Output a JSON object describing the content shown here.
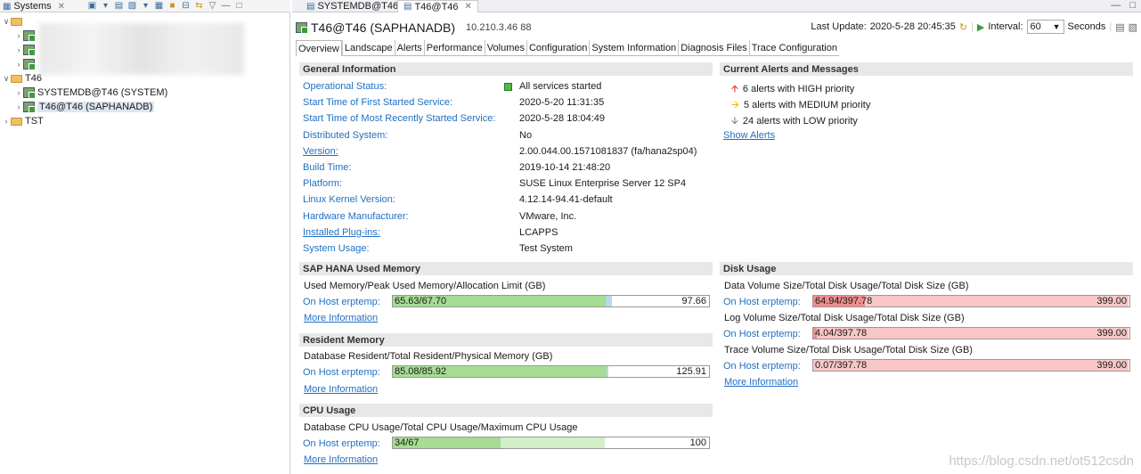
{
  "left_panel": {
    "tab_title": "Systems",
    "tree": [
      {
        "label": "",
        "level": 0,
        "expanded": true
      },
      {
        "label": "",
        "level": 1
      },
      {
        "label": "",
        "level": 1
      },
      {
        "label": "",
        "level": 1
      },
      {
        "label": "T46",
        "level": 0,
        "expanded": true
      },
      {
        "label": "SYSTEMDB@T46 (SYSTEM)",
        "level": 1
      },
      {
        "label": "T46@T46 (SAPHANADB)",
        "level": 1,
        "selected": true
      },
      {
        "label": "TST",
        "level": 0
      }
    ]
  },
  "editor_tabs": [
    {
      "label": "SYSTEMDB@T46",
      "active": false
    },
    {
      "label": "T46@T46",
      "active": true
    }
  ],
  "header": {
    "title": "T46@T46 (SAPHANADB)",
    "ip": "10.210.3.46 88",
    "last_update_label": "Last Update:",
    "last_update_value": "2020-5-28 20:45:35",
    "interval_label": "Interval:",
    "interval_value": "60",
    "seconds_label": "Seconds"
  },
  "subtabs": [
    "Overview",
    "Landscape",
    "Alerts",
    "Performance",
    "Volumes",
    "Configuration",
    "System Information",
    "Diagnosis Files",
    "Trace Configuration"
  ],
  "general": {
    "title": "General Information",
    "rows": [
      {
        "label": "Operational Status:",
        "value": "All services started",
        "link": false
      },
      {
        "label": "Start Time of First Started Service:",
        "value": "2020-5-20 11:31:35",
        "link": false
      },
      {
        "label": "Start Time of Most Recently Started Service:",
        "value": "2020-5-28 18:04:49",
        "link": false
      },
      {
        "label": "Distributed System:",
        "value": "No",
        "link": false
      },
      {
        "label": "Version:",
        "value": "2.00.044.00.1571081837 (fa/hana2sp04)",
        "link": true
      },
      {
        "label": "Build Time:",
        "value": "2019-10-14 21:48:20",
        "link": false
      },
      {
        "label": "Platform:",
        "value": "SUSE Linux Enterprise Server 12 SP4",
        "link": false
      },
      {
        "label": "Linux Kernel Version:",
        "value": "4.12.14-94.41-default",
        "link": false
      },
      {
        "label": "Hardware Manufacturer:",
        "value": "VMware, Inc.",
        "link": false
      },
      {
        "label": "Installed Plug-ins:",
        "value": "LCAPPS",
        "link": true
      },
      {
        "label": "System Usage:",
        "value": "Test System",
        "link": false
      }
    ]
  },
  "alerts": {
    "title": "Current Alerts and Messages",
    "items": [
      {
        "text": "6 alerts with HIGH priority",
        "icon": "arrow-up-icon",
        "color": "#e02020"
      },
      {
        "text": "5 alerts with MEDIUM priority",
        "icon": "arrow-right-icon",
        "color": "#f0b400"
      },
      {
        "text": "24 alerts with LOW priority",
        "icon": "arrow-down-icon",
        "color": "#777777"
      }
    ],
    "show_alerts": "Show Alerts"
  },
  "used_memory": {
    "title": "SAP HANA Used Memory",
    "desc": "Used Memory/Peak Used Memory/Allocation Limit (GB)",
    "host": "On Host erptemp:",
    "bar_text": "65.63/67.70",
    "bar_max": "97.66",
    "used": 65.63,
    "peak": 67.7,
    "limit": 97.66,
    "more": "More Information"
  },
  "resident_memory": {
    "title": "Resident Memory",
    "desc": "Database Resident/Total Resident/Physical Memory (GB)",
    "host": "On Host erptemp:",
    "bar_text": "85.08/85.92",
    "bar_max": "125.91",
    "used": 85.08,
    "peak": 85.92,
    "limit": 125.91,
    "more": "More Information"
  },
  "cpu": {
    "title": "CPU Usage",
    "desc": "Database CPU Usage/Total CPU Usage/Maximum CPU Usage",
    "host": "On Host erptemp:",
    "bar_text": "34/67",
    "bar_max": "100",
    "used": 34,
    "peak": 67,
    "limit": 100,
    "more": "More Information"
  },
  "disk": {
    "title": "Disk Usage",
    "data_desc": "Data Volume Size/Total Disk Usage/Total Disk Size (GB)",
    "data_host": "On Host erptemp:",
    "data_text": "64.94/397.78",
    "data_max": "399.00",
    "data_used": 64.94,
    "log_desc": "Log Volume Size/Total Disk Usage/Total Disk Size (GB)",
    "log_host": "On Host erptemp:",
    "log_text": "4.04/397.78",
    "log_max": "399.00",
    "log_used": 4.04,
    "trace_desc": "Trace Volume Size/Total Disk Usage/Total Disk Size (GB)",
    "trace_host": "On Host erptemp:",
    "trace_text": "0.07/397.78",
    "trace_max": "399.00",
    "trace_used": 0.07,
    "disk_total_usage": 397.78,
    "disk_total_size": 399.0,
    "more": "More Information"
  },
  "watermark": "https://blog.csdn.net/ot512csdn",
  "colors": {
    "link": "#1f6fc2",
    "bar_green": "#a6dc93",
    "bar_red": "#f9c6c6",
    "bar_red_dark": "#ee8d8d",
    "status_green": "#4cbd3f"
  }
}
